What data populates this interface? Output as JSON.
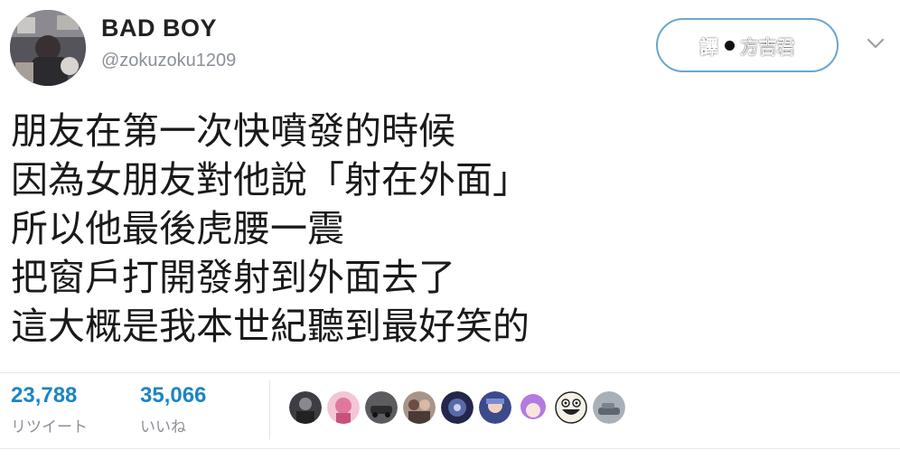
{
  "user": {
    "display_name": "BAD BOY",
    "handle": "@zokuzoku1209",
    "avatar_icon": "profile-photo"
  },
  "follow_button": {
    "badge_text_left": "譯",
    "badge_text_right": "方吉君",
    "border_color": "#6aa6d0"
  },
  "tweet": {
    "lines": [
      "朋友在第一次快噴發的時候",
      "因為女朋友對他說「射在外面」",
      "所以他最後虎腰一震",
      "把窗戶打開發射到外面去了",
      "這大概是我本世紀聽到最好笑的"
    ]
  },
  "stats": {
    "retweets": {
      "count": "23,788",
      "label": "リツイート"
    },
    "likes": {
      "count": "35,066",
      "label": "いいね"
    }
  },
  "likers": [
    {
      "icon": "avatar-dark-photo"
    },
    {
      "icon": "avatar-pink-anime"
    },
    {
      "icon": "avatar-car-photo"
    },
    {
      "icon": "avatar-group-photo"
    },
    {
      "icon": "avatar-night-photo"
    },
    {
      "icon": "avatar-anime-blue"
    },
    {
      "icon": "avatar-purple-hair"
    },
    {
      "icon": "avatar-laughing-face"
    },
    {
      "icon": "avatar-gray-car"
    }
  ],
  "colors": {
    "accent": "#1b84c7",
    "muted": "#8a9099"
  }
}
